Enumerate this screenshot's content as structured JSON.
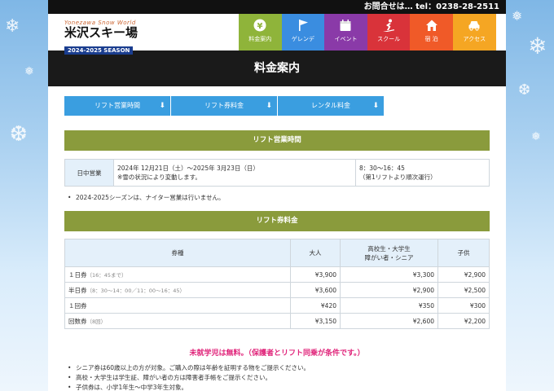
{
  "topbar": {
    "contact": "お問合せは… tel：0238-28-2511"
  },
  "logo": {
    "subtitle": "Yonezawa Snow World",
    "name": "米沢スキー場",
    "season": "2024-2025 SEASON"
  },
  "nav": [
    {
      "label": "料金案内",
      "icon": "yen-coin-icon",
      "color": "#8fb43a"
    },
    {
      "label": "ゲレンデ",
      "icon": "flag-icon",
      "color": "#3a8de0"
    },
    {
      "label": "イベント",
      "icon": "calendar-icon",
      "color": "#8a3aa8"
    },
    {
      "label": "スクール",
      "icon": "skier-icon",
      "color": "#d9333a"
    },
    {
      "label": "宿 泊",
      "icon": "house-icon",
      "color": "#f05a28"
    },
    {
      "label": "アクセス",
      "icon": "car-icon",
      "color": "#f5a623"
    }
  ],
  "page_title": "料金案内",
  "anchors": [
    {
      "label": "リフト営業時間"
    },
    {
      "label": "リフト券料金"
    },
    {
      "label": "レンタル料金"
    }
  ],
  "lift_hours": {
    "heading": "リフト営業時間",
    "row_label": "日中営業",
    "period_line1": "2024年 12月21日（土）〜2025年 3月23日（日）",
    "period_line2": "※雪の状況により変動します。",
    "time_line1": "8：30〜16：45",
    "time_line2": "（第1リフトより順次運行）",
    "note": "2024-2025シーズンは、ナイター営業は行いません。"
  },
  "tickets": {
    "heading": "リフト券料金",
    "headers": [
      "券種",
      "大人",
      "高校生・大学生",
      "障がい者・シニア",
      "子供"
    ],
    "rows": [
      {
        "name": "１日券",
        "sub": "（16：45まで）",
        "adult": "¥3,900",
        "student": "¥3,300",
        "child": "¥2,900"
      },
      {
        "name": "半日券",
        "sub": "（8：30〜14：00／11：00〜16：45）",
        "adult": "¥3,600",
        "student": "¥2,900",
        "child": "¥2,500"
      },
      {
        "name": "１回券",
        "sub": "",
        "adult": "¥420",
        "student": "¥350",
        "child": "¥300"
      },
      {
        "name": "回数券",
        "sub": "（8回）",
        "adult": "¥3,150",
        "student": "¥2,600",
        "child": "¥2,200"
      }
    ]
  },
  "free_note": "未就学児は無料。（保護者とリフト同乗が条件です。）",
  "bullets": [
    "シニア券は60歳以上の方が対象。ご購入の際は年齢を証明する物をご提示ください。",
    "高校・大学生は学生証、障がい者の方は障害者手帳をご提示ください。",
    "子供券は、小学1年生〜中学3年生対象。"
  ]
}
